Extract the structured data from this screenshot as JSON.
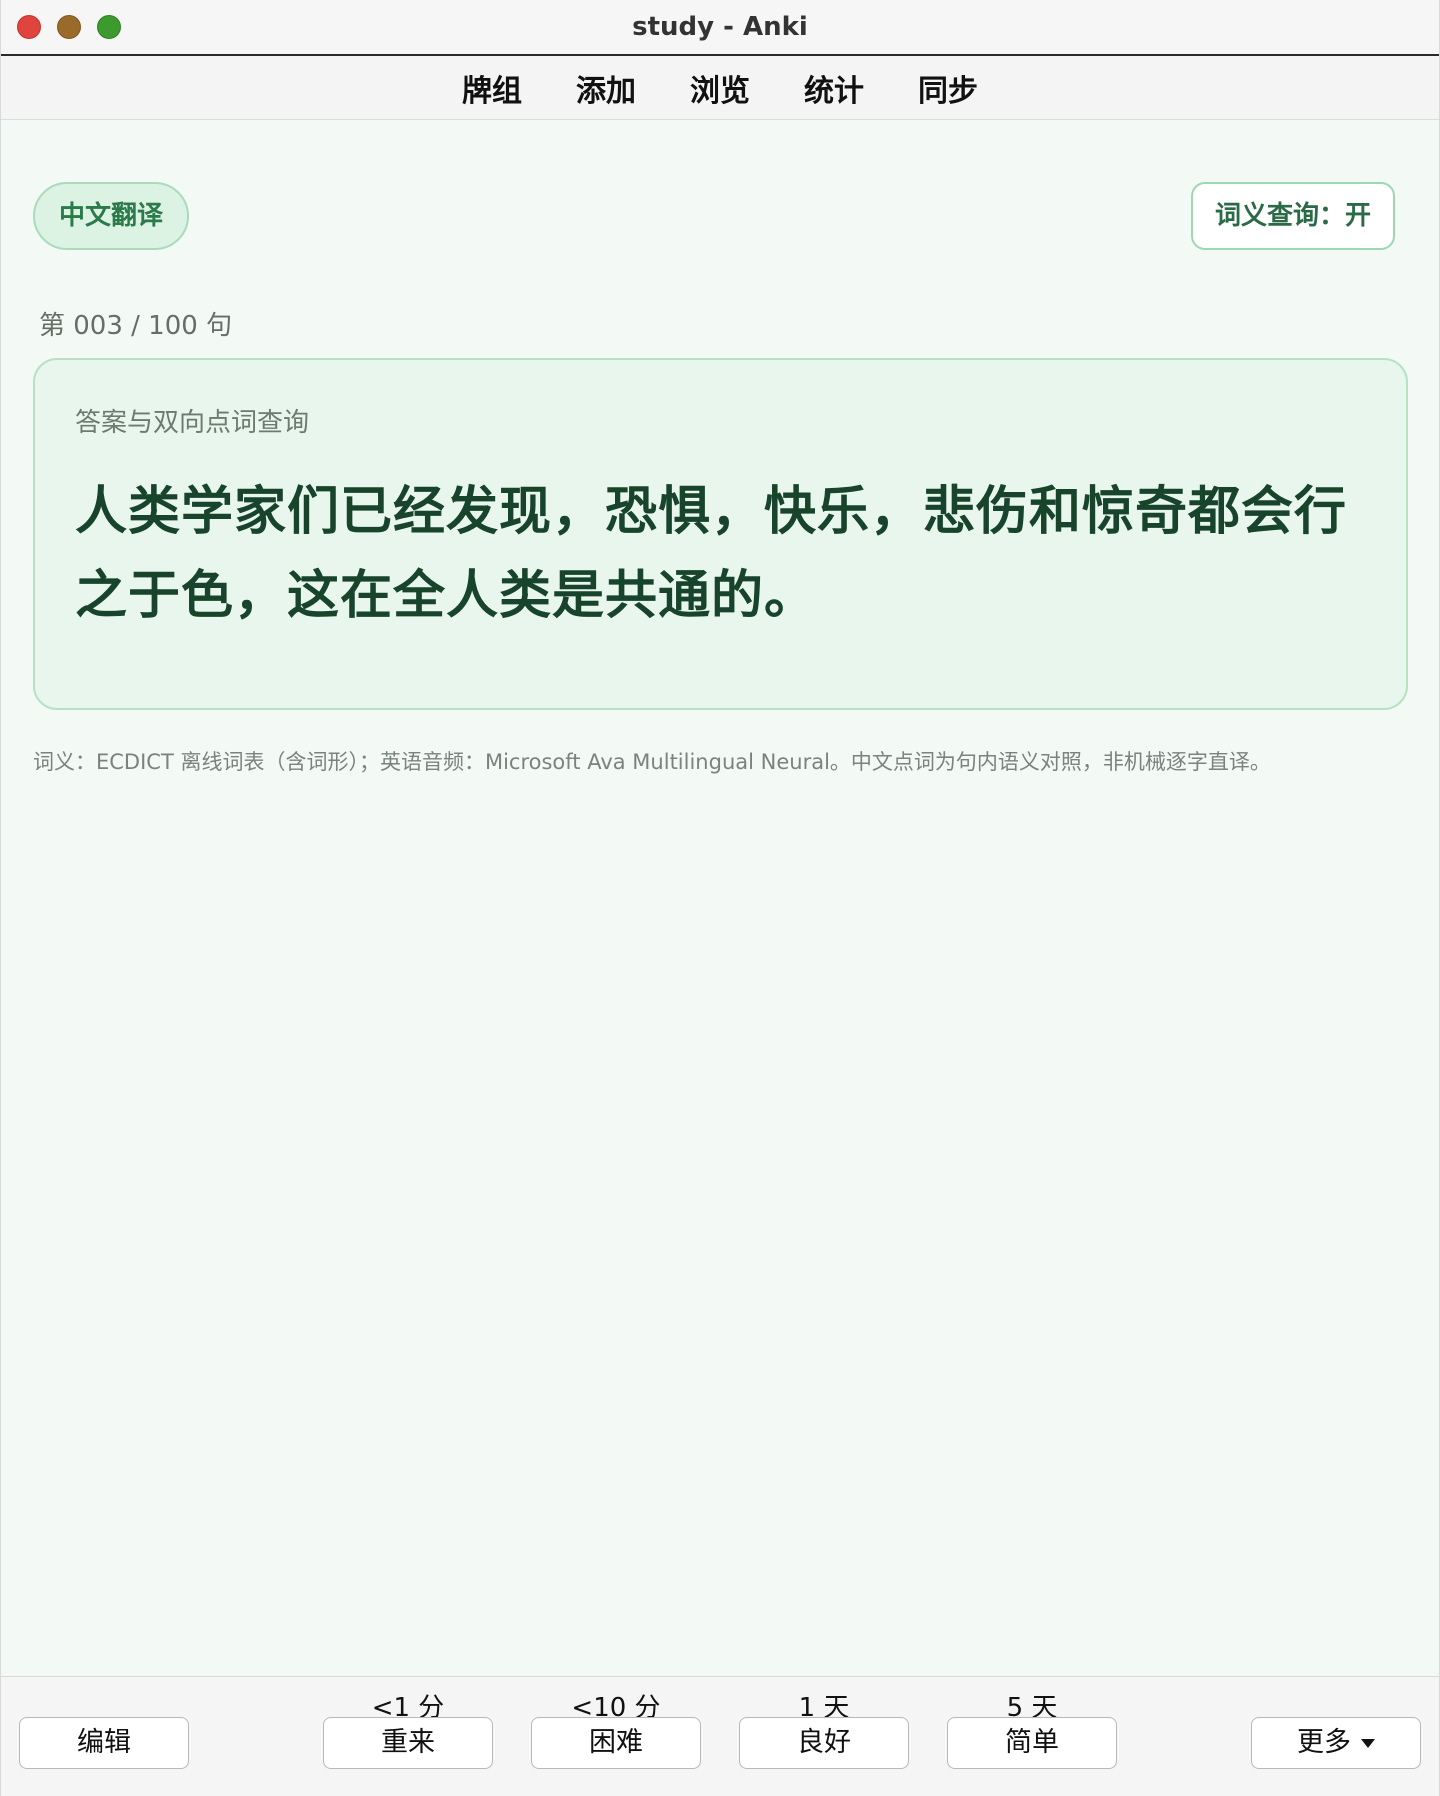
{
  "window": {
    "title": "study - Anki"
  },
  "toolbar": {
    "items": [
      "牌组",
      "添加",
      "浏览",
      "统计",
      "同步"
    ]
  },
  "content": {
    "mode_pill": "中文翻译",
    "lookup_toggle": "词义查询：开",
    "counter": "第 003 / 100 句",
    "card_label": "答案与双向点词查询",
    "sentence": "人类学家们已经发现，恐惧，快乐，悲伤和惊奇都会行之于色，这在全人类是共通的。",
    "footnote": "词义：ECDICT 离线词表（含词形）；英语音频：Microsoft Ava Multilingual Neural。中文点词为句内语义对照，非机械逐字直译。"
  },
  "answer_bar": {
    "edit_label": "编辑",
    "more_label": "更多",
    "buttons": [
      {
        "interval": "<1 分",
        "label": "重来"
      },
      {
        "interval": "<10 分",
        "label": "困难"
      },
      {
        "interval": "1 天",
        "label": "良好"
      },
      {
        "interval": "5 天",
        "label": "简单"
      }
    ]
  },
  "colors": {
    "background": "#f3f9f5",
    "card_background": "#e9f6ee",
    "card_border": "#b6e2c4",
    "accent_text": "#17442b",
    "pill_text": "#2a7a4a"
  },
  "icons": {
    "more_dropdown": "caret-down-icon"
  }
}
